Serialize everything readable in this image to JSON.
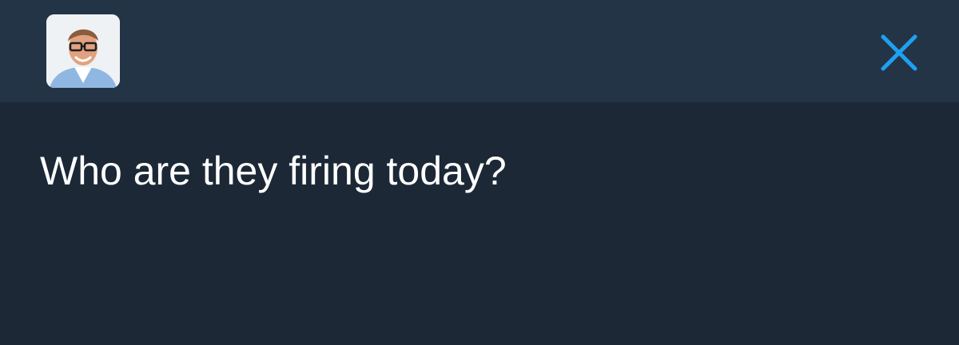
{
  "header": {
    "avatar": {
      "icon": "profile-photo"
    },
    "close": {
      "icon": "close-icon",
      "color": "#1da1f2"
    }
  },
  "compose": {
    "text": "Who are they firing today?"
  },
  "colors": {
    "header_background": "#243447",
    "body_background": "#1c2836",
    "text": "#ffffff",
    "accent": "#1da1f2"
  }
}
